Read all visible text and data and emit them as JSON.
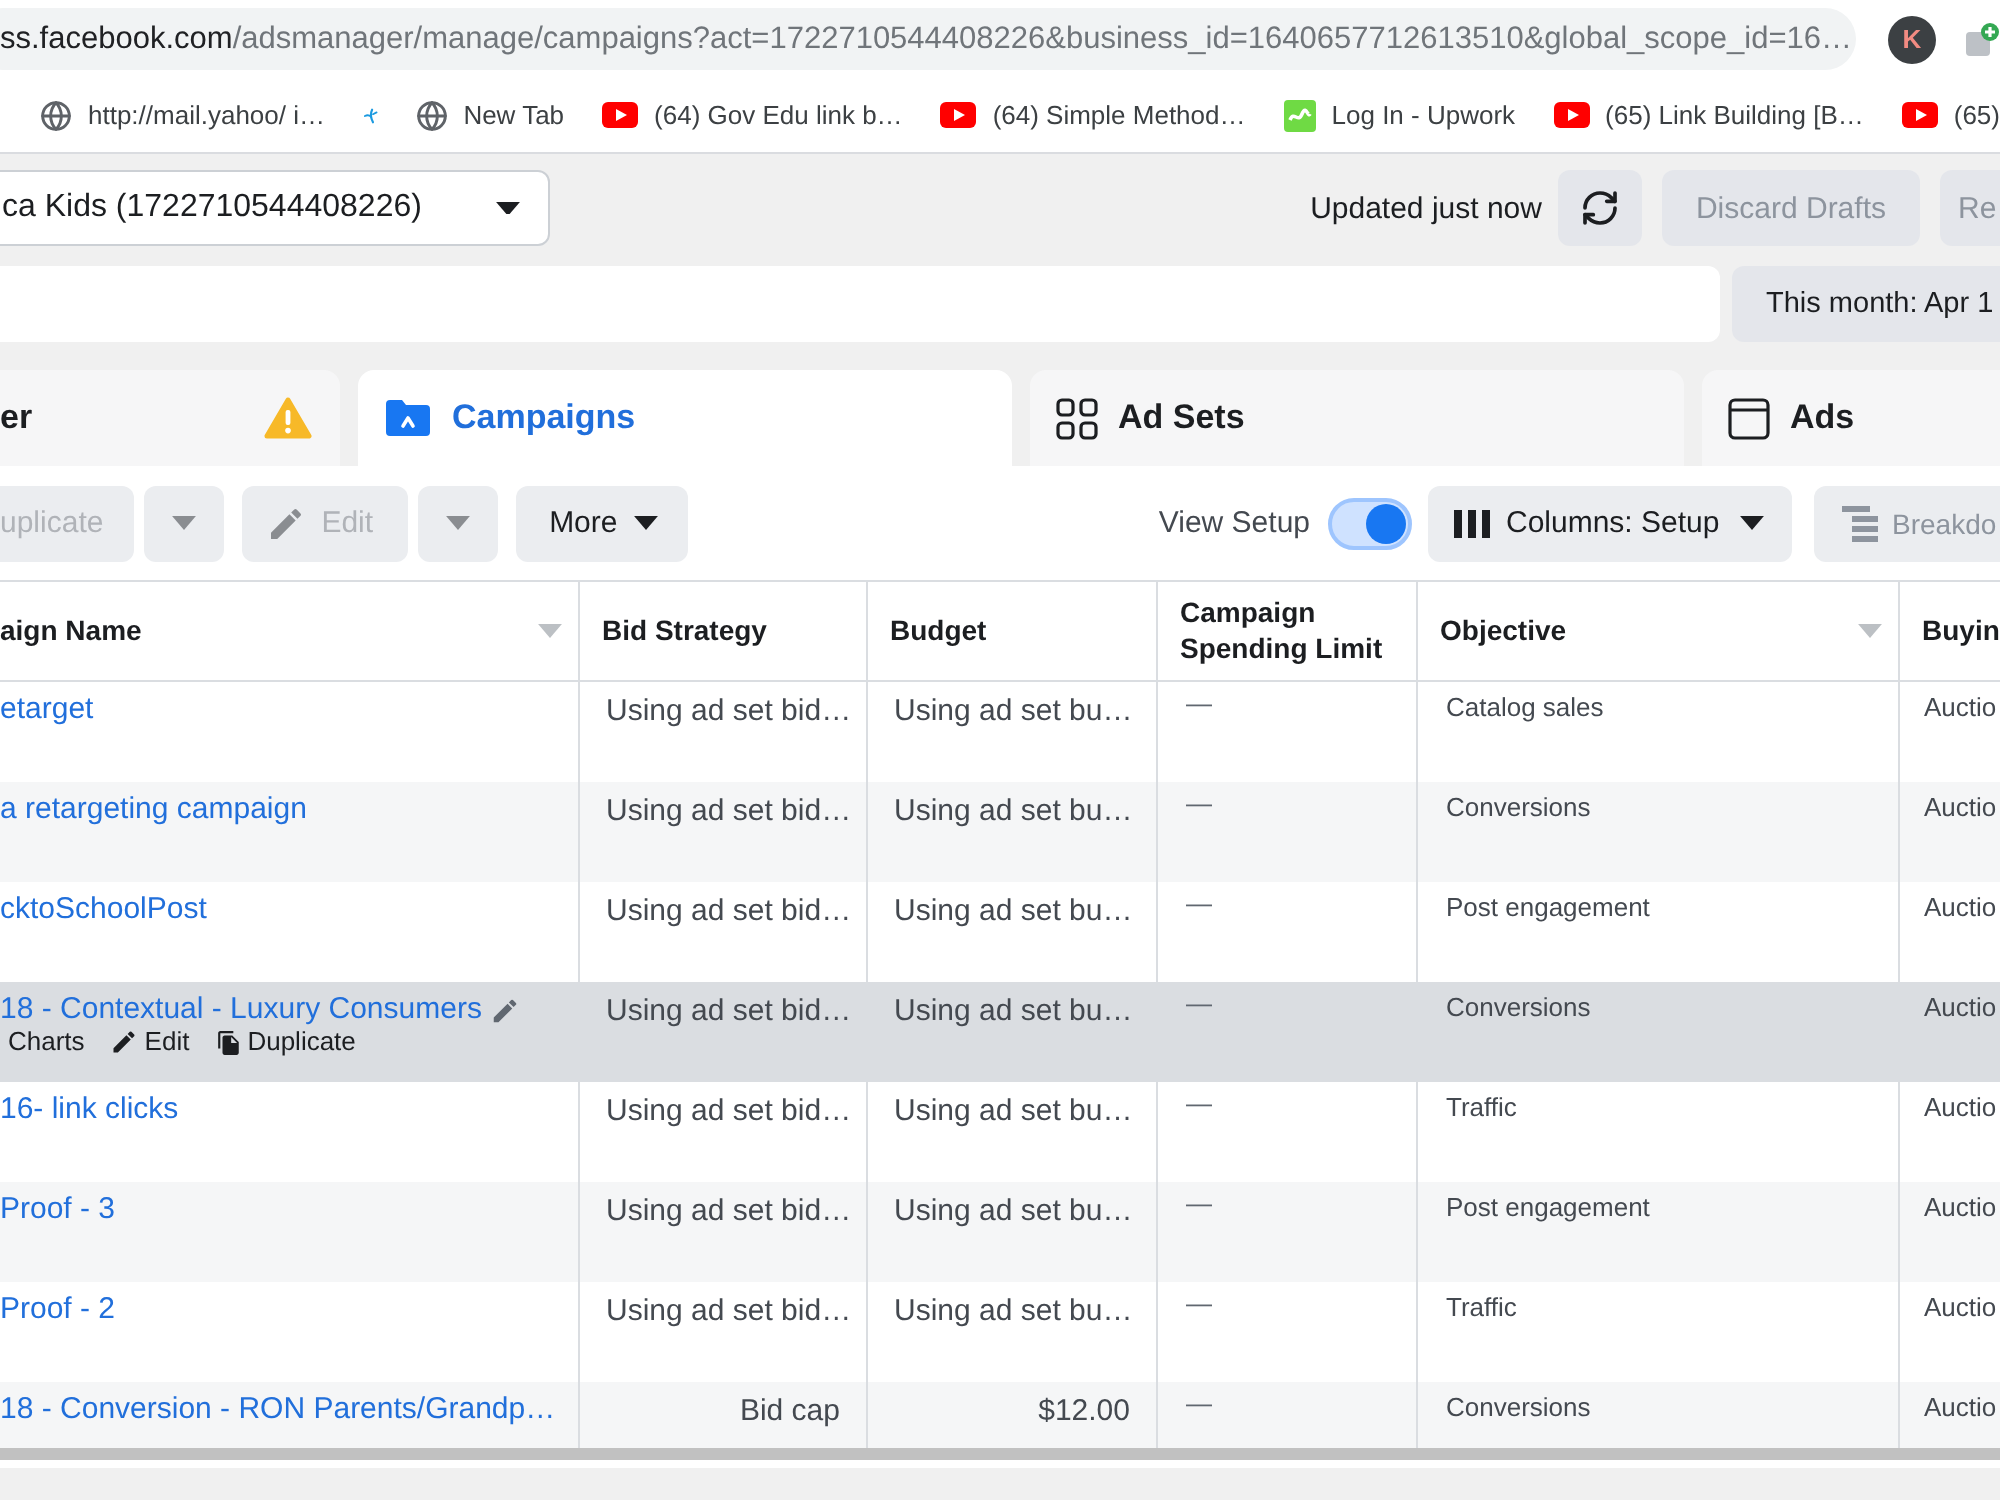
{
  "browser": {
    "url": {
      "host": "ss.facebook.com",
      "path": "/adsmanager/manage/campaigns?act=1722710544408226&business_id=1640657712613510&global_scope_id=16…"
    },
    "profile_initial": "K"
  },
  "bookmarks": [
    {
      "kind": "globe",
      "label": "http://mail.yahoo/ i…"
    },
    {
      "kind": "logo"
    },
    {
      "kind": "globe",
      "label": "New Tab"
    },
    {
      "kind": "video",
      "label": "(64) Gov Edu link b…"
    },
    {
      "kind": "video",
      "label": "(64) Simple Method…"
    },
    {
      "kind": "tile",
      "label": "Log In - Upwork"
    },
    {
      "kind": "video",
      "label": "(65) Link Building [B…"
    },
    {
      "kind": "video",
      "label": "(65)"
    }
  ],
  "account": {
    "name": "ca Kids (1722710544408226)"
  },
  "sync": {
    "status": "Updated just now"
  },
  "header_buttons": [
    {
      "label": "Discard Drafts",
      "disabled": true
    },
    {
      "label": "Re",
      "disabled": true
    }
  ],
  "date_range": {
    "label": "This month: Apr 1"
  },
  "tabs": [
    {
      "kind": "overview",
      "label": "er",
      "selected": false,
      "warning": true
    },
    {
      "kind": "campaigns",
      "label": "Campaigns",
      "selected": true,
      "warning": false
    },
    {
      "kind": "ad_sets",
      "label": "Ad Sets",
      "selected": false,
      "warning": false
    },
    {
      "kind": "ads",
      "label": "Ads",
      "selected": false,
      "warning": false
    }
  ],
  "toolbar": {
    "actions": [
      {
        "kind": "text",
        "label": "uplicate",
        "disabled": true
      },
      {
        "kind": "caret",
        "disabled": true
      },
      {
        "kind": "pencil",
        "label": "Edit",
        "disabled": true
      },
      {
        "kind": "caret",
        "disabled": true
      },
      {
        "kind": "menu",
        "label": "More",
        "disabled": false
      }
    ],
    "view_setup": {
      "label": "View Setup",
      "on": true
    },
    "columns": {
      "label": "Columns: Setup"
    },
    "breakdown": {
      "label": "Breakdo",
      "disabled": true
    }
  },
  "table": {
    "columns": [
      {
        "label": "aign Name",
        "menu": true
      },
      {
        "label": "Bid Strategy",
        "menu": false
      },
      {
        "label": "Budget",
        "menu": false
      },
      {
        "label": "Campaign Spending Limit",
        "menu": false
      },
      {
        "label": "Objective",
        "menu": true
      },
      {
        "label": "Buyin",
        "menu": false
      }
    ],
    "rows": [
      {
        "kind": "ad_set",
        "name": "etarget",
        "bid_strategy": "Using ad set bid…",
        "budget": "Using ad set bu…",
        "spending_limit": "—",
        "objective": "Catalog sales",
        "buying_type": "Auctio",
        "hovered": false
      },
      {
        "kind": "ad_set",
        "name": "a retargeting campaign",
        "bid_strategy": "Using ad set bid…",
        "budget": "Using ad set bu…",
        "spending_limit": "—",
        "objective": "Conversions",
        "buying_type": "Auctio",
        "hovered": false
      },
      {
        "kind": "ad_set",
        "name": "cktoSchoolPost",
        "bid_strategy": "Using ad set bid…",
        "budget": "Using ad set bu…",
        "spending_limit": "—",
        "objective": "Post engagement",
        "buying_type": "Auctio",
        "hovered": false
      },
      {
        "kind": "ad_set",
        "name": "18 - Contextual - Luxury Consumers",
        "bid_strategy": "Using ad set bid…",
        "budget": "Using ad set bu…",
        "spending_limit": "—",
        "objective": "Conversions",
        "buying_type": "Auctio",
        "hovered": true,
        "actions": [
          {
            "kind": "charts",
            "label": "Charts"
          },
          {
            "kind": "edit",
            "label": "Edit"
          },
          {
            "kind": "duplicate",
            "label": "Duplicate"
          }
        ]
      },
      {
        "kind": "ad_set",
        "name": "16- link clicks",
        "bid_strategy": "Using ad set bid…",
        "budget": "Using ad set bu…",
        "spending_limit": "—",
        "objective": "Traffic",
        "buying_type": "Auctio",
        "hovered": false
      },
      {
        "kind": "ad_set",
        "name": "Proof - 3",
        "bid_strategy": "Using ad set bid…",
        "budget": "Using ad set bu…",
        "spending_limit": "—",
        "objective": "Post engagement",
        "buying_type": "Auctio",
        "hovered": false
      },
      {
        "kind": "ad_set",
        "name": "Proof - 2",
        "bid_strategy": "Using ad set bid…",
        "budget": "Using ad set bu…",
        "spending_limit": "—",
        "objective": "Traffic",
        "buying_type": "Auctio",
        "hovered": false
      },
      {
        "kind": "campaign",
        "name": "18 - Conversion - RON Parents/Grandp…",
        "bid_strategy": "Bid cap",
        "budget": "$12.00",
        "spending_limit": "—",
        "objective": "Conversions",
        "buying_type": "Auctio",
        "hovered": false
      }
    ]
  }
}
